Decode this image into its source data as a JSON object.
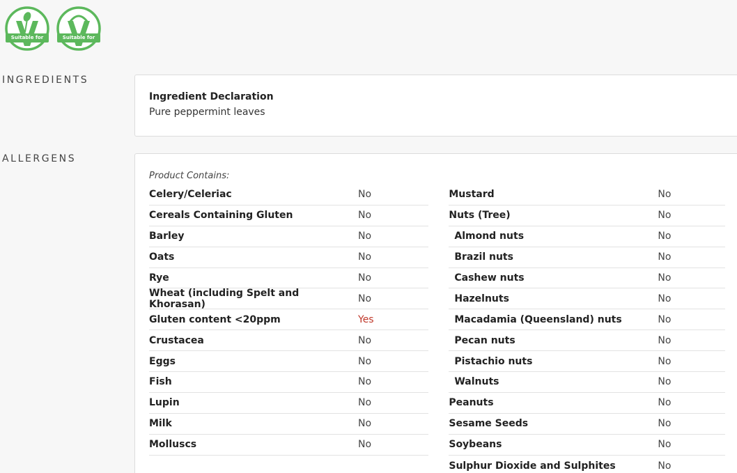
{
  "badges": [
    {
      "icon": "vegan-v-icon",
      "label": "Suitable for",
      "color": "#5cb85c"
    },
    {
      "icon": "vegan-v-icon",
      "label": "Suitable for",
      "color": "#5cb85c"
    }
  ],
  "ingredients": {
    "heading": "INGREDIENTS",
    "declaration_title": "Ingredient Declaration",
    "declaration_text": "Pure peppermint leaves"
  },
  "allergens": {
    "heading": "ALLERGENS",
    "contains_label": "Product Contains:",
    "yes_color": "#c0392b",
    "left": [
      {
        "name": "Celery/Celeriac",
        "value": "No",
        "sub": false
      },
      {
        "name": "Cereals Containing Gluten",
        "value": "No",
        "sub": false
      },
      {
        "name": "Barley",
        "value": "No",
        "sub": false
      },
      {
        "name": "Oats",
        "value": "No",
        "sub": false
      },
      {
        "name": "Rye",
        "value": "No",
        "sub": false
      },
      {
        "name": "Wheat (including Spelt and Khorasan)",
        "value": "No",
        "sub": false
      },
      {
        "name": "Gluten content <20ppm",
        "value": "Yes",
        "sub": false
      },
      {
        "name": "Crustacea",
        "value": "No",
        "sub": false
      },
      {
        "name": "Eggs",
        "value": "No",
        "sub": false
      },
      {
        "name": "Fish",
        "value": "No",
        "sub": false
      },
      {
        "name": "Lupin",
        "value": "No",
        "sub": false
      },
      {
        "name": "Milk",
        "value": "No",
        "sub": false
      },
      {
        "name": "Molluscs",
        "value": "No",
        "sub": false
      }
    ],
    "right": [
      {
        "name": "Mustard",
        "value": "No",
        "sub": false
      },
      {
        "name": "Nuts (Tree)",
        "value": "No",
        "sub": false
      },
      {
        "name": "Almond nuts",
        "value": "No",
        "sub": true
      },
      {
        "name": "Brazil nuts",
        "value": "No",
        "sub": true
      },
      {
        "name": "Cashew nuts",
        "value": "No",
        "sub": true
      },
      {
        "name": "Hazelnuts",
        "value": "No",
        "sub": true
      },
      {
        "name": "Macadamia (Queensland) nuts",
        "value": "No",
        "sub": true
      },
      {
        "name": "Pecan nuts",
        "value": "No",
        "sub": true
      },
      {
        "name": "Pistachio nuts",
        "value": "No",
        "sub": true
      },
      {
        "name": "Walnuts",
        "value": "No",
        "sub": true
      },
      {
        "name": "Peanuts",
        "value": "No",
        "sub": false
      },
      {
        "name": "Sesame Seeds",
        "value": "No",
        "sub": false
      },
      {
        "name": "Soybeans",
        "value": "No",
        "sub": false
      },
      {
        "name": "Sulphur Dioxide and Sulphites",
        "value": "No",
        "sub": false
      }
    ]
  }
}
